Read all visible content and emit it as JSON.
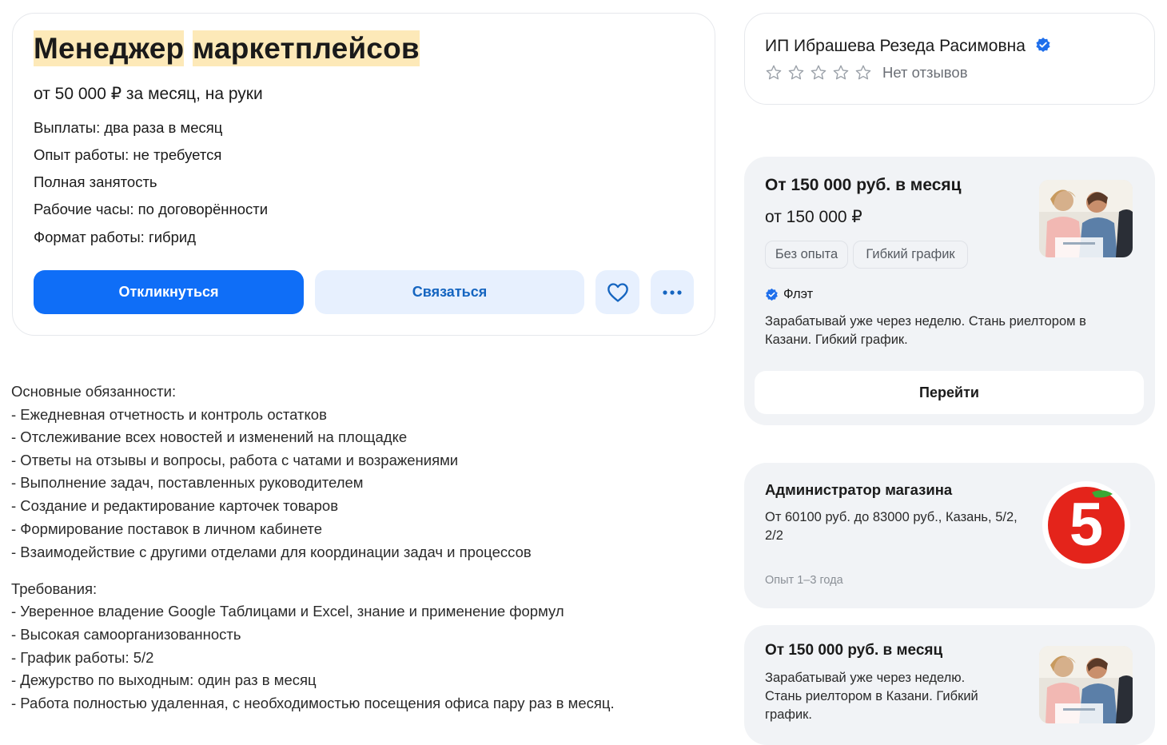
{
  "vacancy": {
    "title_part1": "Менеджер",
    "title_part2": "маркетплейсов",
    "salary": "от 50 000 ₽ за месяц, на руки",
    "details": [
      "Выплаты: два раза в месяц",
      "Опыт работы: не требуется",
      "Полная занятость",
      "Рабочие часы: по договорённости",
      "Формат работы: гибрид"
    ],
    "respond_label": "Откликнуться",
    "contact_label": "Связаться",
    "favorite_icon": "heart-icon",
    "more_icon": "more-dots-icon"
  },
  "description": {
    "duties_heading": "Основные обязанности:",
    "duties": [
      "- Ежедневная отчетность и контроль остатков",
      "- Отслеживание всех новостей и изменений на площадке",
      "- Ответы на отзывы и вопросы, работа с чатами и возражениями",
      "- Выполнение задач, поставленных руководителем",
      "- Создание и редактирование карточек товаров",
      "- Формирование поставок в личном кабинете",
      "- Взаимодействие с другими отделами для координации задач и процессов"
    ],
    "req_heading": "Требования:",
    "requirements": [
      "- Уверенное владение Google Таблицами и Excel, знание и применение формул",
      "- Высокая самоорганизованность",
      "- График работы: 5/2",
      "- Дежурство по выходным: один раз в месяц",
      "- Работа полностью удаленная, с необходимостью посещения офиса пару раз в месяц."
    ]
  },
  "employer": {
    "name": "ИП Ибрашева Резеда Расимовна",
    "verified_icon": "verified-badge-icon",
    "rating_stars": 0,
    "reviews_text": "Нет отзывов"
  },
  "ads": {
    "ad1": {
      "title": "От 150 000 руб. в месяц",
      "salary": "от 150 000  ₽",
      "tags": [
        "Без опыта",
        "Гибкий график"
      ],
      "company": "Флэт",
      "text": "Зарабатывай уже через неделю. Стань риелтором в Казани. Гибкий график.",
      "button": "Перейти"
    },
    "ad2": {
      "title": "Администратор магазина",
      "text": "От 60100 руб. до 83000 руб., Казань, 5/2, 2/2",
      "experience": "Опыт 1–3 года",
      "logo_text": "5",
      "logo_color": "#e4241b"
    },
    "ad3": {
      "title": "От 150 000 руб. в месяц",
      "text": "Зарабатывай уже через неделю. Стань риелтором в Казани. Гибкий график."
    }
  },
  "colors": {
    "primary": "#0f6ef7",
    "secondary_bg": "#e7f0fe",
    "title_highlight": "#fde9b8",
    "verified": "#1f6feb"
  }
}
